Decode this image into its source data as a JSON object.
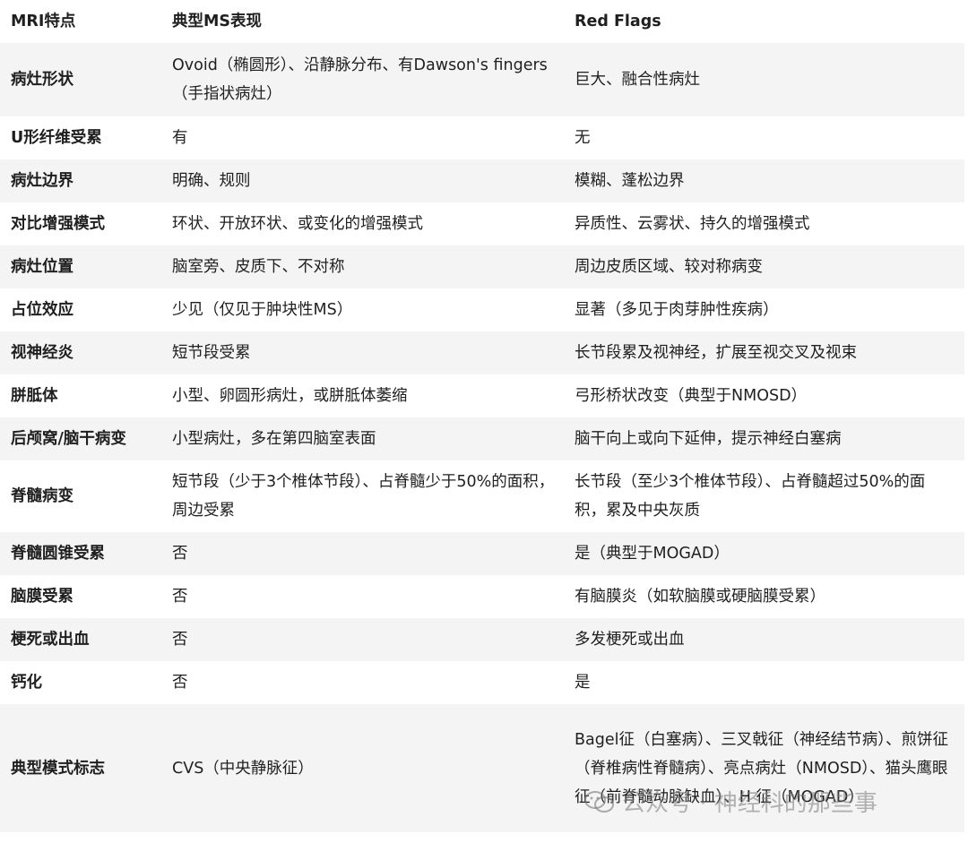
{
  "header": {
    "col1": "MRI特点",
    "col2": "典型MS表现",
    "col3": "Red Flags"
  },
  "rows": [
    {
      "feature": "病灶形状",
      "ms": "Ovoid（椭圆形）、沿静脉分布、有Dawson's fingers（手指状病灶）",
      "red": "巨大、融合性病灶"
    },
    {
      "feature": "U形纤维受累",
      "ms": "有",
      "red": "无"
    },
    {
      "feature": "病灶边界",
      "ms": "明确、规则",
      "red": "模糊、蓬松边界"
    },
    {
      "feature": "对比增强模式",
      "ms": "环状、开放环状、或变化的增强模式",
      "red": "异质性、云雾状、持久的增强模式"
    },
    {
      "feature": "病灶位置",
      "ms": "脑室旁、皮质下、不对称",
      "red": "周边皮质区域、较对称病变"
    },
    {
      "feature": "占位效应",
      "ms": "少见（仅见于肿块性MS）",
      "red": "显著（多见于肉芽肿性疾病）"
    },
    {
      "feature": "视神经炎",
      "ms": "短节段受累",
      "red": "长节段累及视神经，扩展至视交叉及视束"
    },
    {
      "feature": "胼胝体",
      "ms": "小型、卵圆形病灶，或胼胝体萎缩",
      "red": "弓形桥状改变（典型于NMOSD）"
    },
    {
      "feature": "后颅窝/脑干病变",
      "ms": "小型病灶，多在第四脑室表面",
      "red": "脑干向上或向下延伸，提示神经白塞病"
    },
    {
      "feature": "脊髓病变",
      "ms": "短节段（少于3个椎体节段）、占脊髓少于50%的面积，周边受累",
      "red": "长节段（至少3个椎体节段）、占脊髓超过50%的面积，累及中央灰质"
    },
    {
      "feature": "脊髓圆锥受累",
      "ms": "否",
      "red": "是（典型于MOGAD）"
    },
    {
      "feature": "脑膜受累",
      "ms": "否",
      "red": "有脑膜炎（如软脑膜或硬脑膜受累）"
    },
    {
      "feature": "梗死或出血",
      "ms": "否",
      "red": "多发梗死或出血"
    },
    {
      "feature": "钙化",
      "ms": "否",
      "red": "是"
    },
    {
      "feature": "典型模式标志",
      "ms": "CVS（中央静脉征）",
      "red": "Bagel征（白塞病）、三叉戟征（神经结节病）、煎饼征（脊椎病性脊髓病）、亮点病灶（NMOSD）、猫头鹰眼征（前脊髓动脉缺血）、H 征（MOGAD）"
    }
  ],
  "watermark": {
    "text": "公众号 · 神经科的那些事",
    "icon": "wechat-icon"
  }
}
